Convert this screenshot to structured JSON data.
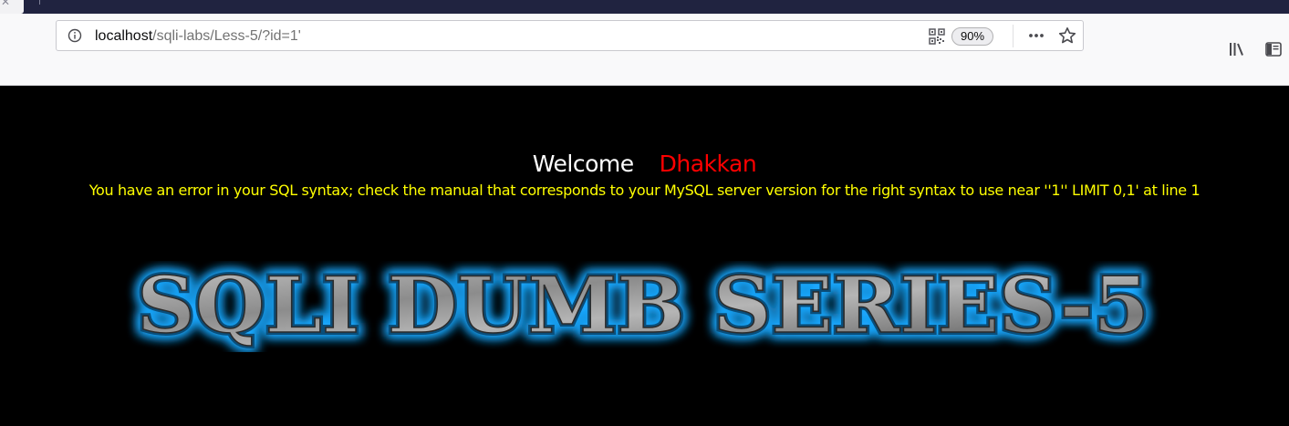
{
  "browser": {
    "url_host": "localhost",
    "url_path": "/sqli-labs/Less-5/?id=1'",
    "zoom": "90%",
    "icons": [
      "tab-close-icon",
      "info-icon",
      "qr-code-icon",
      "more-icon",
      "star-icon",
      "library-icon",
      "sidebar-icon"
    ]
  },
  "page": {
    "welcome": "Welcome",
    "username": "Dhakkan",
    "error": "You have an error in your SQL syntax; check the manual that corresponds to your MySQL server version for the right syntax to use near ''1'' LIMIT 0,1' at line 1",
    "banner": "SQLI DUMB SERIES-5"
  },
  "colors": {
    "background": "#000000",
    "welcome": "#ffffff",
    "username": "#ff0000",
    "error": "#ffff00",
    "banner_glow": "#1fa8ff",
    "banner_fill": "#9a9a9a"
  }
}
